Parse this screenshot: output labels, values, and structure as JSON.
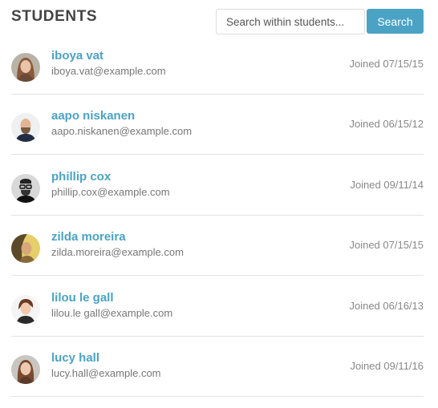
{
  "header": {
    "title": "STUDENTS",
    "search_placeholder": "Search within students...",
    "search_button": "Search"
  },
  "students": [
    {
      "name": "iboya vat",
      "email": "iboya.vat@example.com",
      "joined": "Joined 07/15/15",
      "avatar": "user-photo-icon"
    },
    {
      "name": "aapo niskanen",
      "email": "aapo.niskanen@example.com",
      "joined": "Joined 06/15/12",
      "avatar": "user-photo-icon"
    },
    {
      "name": "phillip cox",
      "email": "phillip.cox@example.com",
      "joined": "Joined 09/11/14",
      "avatar": "user-photo-icon"
    },
    {
      "name": "zilda moreira",
      "email": "zilda.moreira@example.com",
      "joined": "Joined 07/15/15",
      "avatar": "user-photo-icon"
    },
    {
      "name": "lilou le gall",
      "email": "lilou.le gall@example.com",
      "joined": "Joined 06/16/13",
      "avatar": "user-photo-icon"
    },
    {
      "name": "lucy hall",
      "email": "lucy.hall@example.com",
      "joined": "Joined 09/11/16",
      "avatar": "user-photo-icon"
    }
  ],
  "colors": {
    "accent": "#4aa3c5",
    "title": "#444444",
    "muted_text": "#777777",
    "divider": "#e3e3e3"
  }
}
